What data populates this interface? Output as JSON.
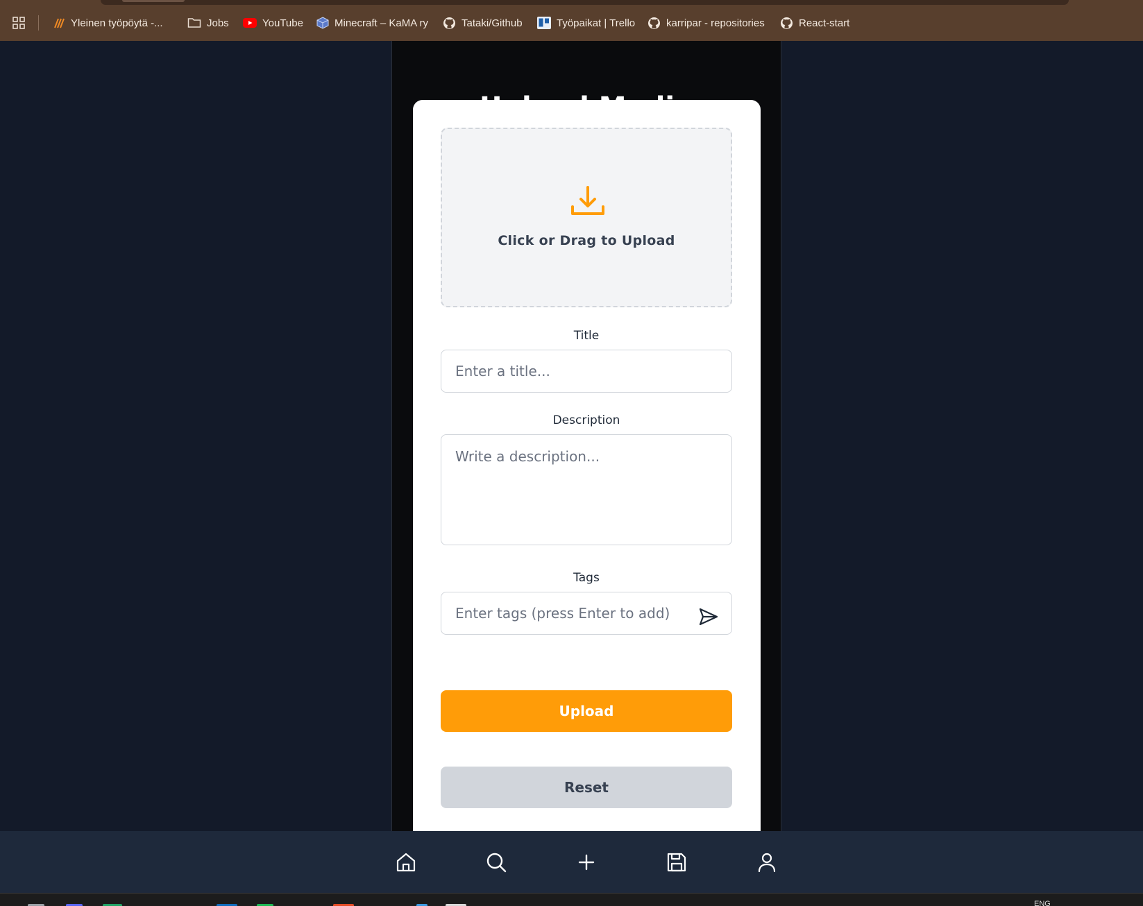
{
  "bookmarks": [
    {
      "label": "Yleinen työpöytä -...",
      "icon": "brand-icon"
    },
    {
      "label": "Jobs",
      "icon": "folder-icon"
    },
    {
      "label": "YouTube",
      "icon": "youtube-icon"
    },
    {
      "label": "Minecraft – KaMA ry",
      "icon": "minecraft-icon"
    },
    {
      "label": "Tataki/Github",
      "icon": "github-icon"
    },
    {
      "label": "Työpaikat | Trello",
      "icon": "trello-icon"
    },
    {
      "label": "karripar - repositories",
      "icon": "github-icon"
    },
    {
      "label": "React-start",
      "icon": "github-icon"
    }
  ],
  "page": {
    "title": "Upload Media"
  },
  "upload_form": {
    "dropzone_label": "Click or Drag to Upload",
    "dropzone_icon": "download-icon",
    "title_label": "Title",
    "title_placeholder": "Enter a title...",
    "title_value": "",
    "description_label": "Description",
    "description_placeholder": "Write a description...",
    "description_value": "",
    "tags_label": "Tags",
    "tags_placeholder": "Enter tags (press Enter to add)",
    "tags_value": "",
    "tags_submit_icon": "send-icon",
    "upload_button": "Upload",
    "reset_button": "Reset"
  },
  "bottom_nav": [
    {
      "icon": "home-icon"
    },
    {
      "icon": "search-icon"
    },
    {
      "icon": "plus-icon"
    },
    {
      "icon": "save-icon"
    },
    {
      "icon": "user-icon"
    }
  ],
  "taskbar": {
    "language": "ENG"
  },
  "colors": {
    "accent": "#ff9c08",
    "background": "#131a29",
    "panel": "#0a0b0d",
    "nav": "#1e293b",
    "bookmarks_bar": "#583f2d"
  }
}
